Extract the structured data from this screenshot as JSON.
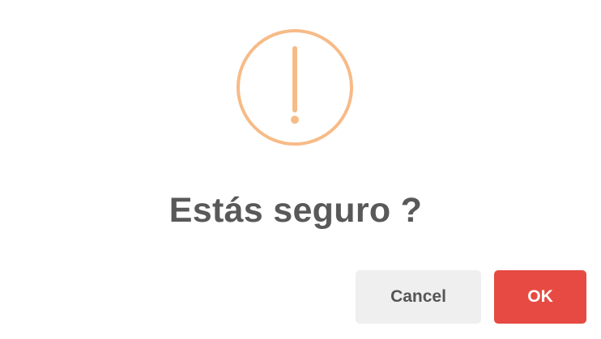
{
  "dialog": {
    "icon": "warning-exclamation-icon",
    "icon_color": "#f7bb87",
    "title": "Estás seguro ?",
    "cancel_label": "Cancel",
    "ok_label": "OK",
    "ok_color": "#e64a42",
    "cancel_color": "#efefef"
  }
}
